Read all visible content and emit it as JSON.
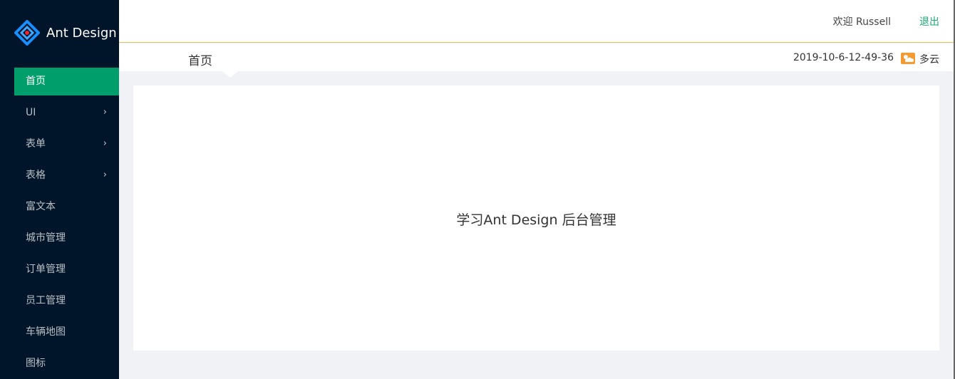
{
  "logo": {
    "text": "Ant Design",
    "icon": "ant-design-logo-icon"
  },
  "menu": [
    {
      "label": "首页",
      "selected": true,
      "arrow": ""
    },
    {
      "label": "UI",
      "arrow": "›"
    },
    {
      "label": "表单",
      "arrow": "›"
    },
    {
      "label": "表格",
      "arrow": "›"
    },
    {
      "label": "富文本",
      "arrow": ""
    },
    {
      "label": "城市管理",
      "arrow": ""
    },
    {
      "label": "订单管理",
      "arrow": ""
    },
    {
      "label": "员工管理",
      "arrow": ""
    },
    {
      "label": "车辆地图",
      "arrow": ""
    },
    {
      "label": "图标",
      "arrow": ""
    }
  ],
  "header": {
    "welcome": "欢迎 Russell",
    "logout": "退出"
  },
  "breadcrumb": {
    "title": "首页",
    "date": "2019-10-6-12-49-36",
    "weather_icon": "weather-cloudy-icon",
    "weather": "多云"
  },
  "content": {
    "message": "学习Ant Design 后台管理"
  },
  "colors": {
    "sidebar": "#001529",
    "accent": "#009e6a",
    "link": "#1aaa72",
    "header_border": "#e6c15b"
  }
}
